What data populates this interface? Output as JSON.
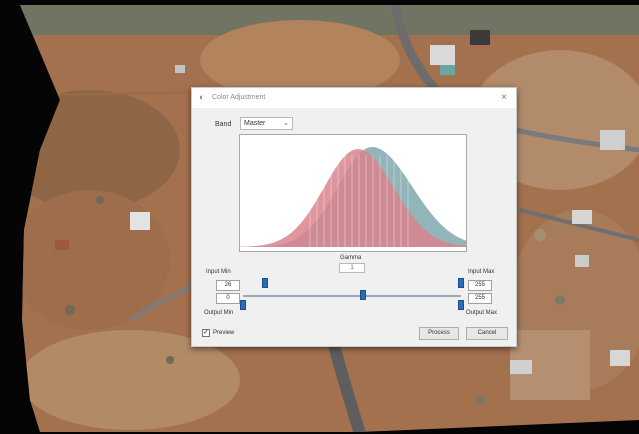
{
  "dialog": {
    "title": "Color Adjustment",
    "title_icon": "color-adjust-icon",
    "close_glyph": "×",
    "band_label": "Band",
    "band_value": "Master",
    "gamma_label": "Gamma",
    "gamma_value": "1",
    "input_min_label": "Input Min",
    "input_max_label": "Input Max",
    "output_min_label": "Output Min",
    "output_max_label": "Output Max",
    "input_min_value": "26",
    "input_max_value": "255",
    "output_min_value": "0",
    "output_max_value": "255",
    "preview_label": "Preview",
    "preview_checked": true,
    "process_label": "Process",
    "cancel_label": "Cancel"
  },
  "levels": {
    "range_max": 255,
    "input_min": 26,
    "input_max": 255,
    "output_min": 0,
    "output_max": 255,
    "gamma_fraction": 0.5
  },
  "colors": {
    "histogram_red": "#d9848d",
    "histogram_teal": "#7fa8ae",
    "slider_handle": "#2b6cb8"
  }
}
